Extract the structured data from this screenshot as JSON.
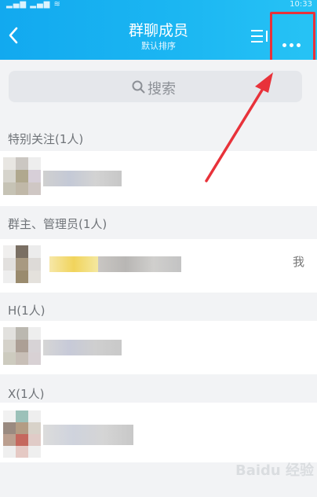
{
  "header": {
    "title": "群聊成员",
    "subtitle": "默认排序",
    "status_time": "10:33"
  },
  "search": {
    "placeholder": "搜索"
  },
  "sections": [
    {
      "label": "特别关注(1人)"
    },
    {
      "label": "群主、管理员(1人)"
    },
    {
      "label": "H(1人)"
    },
    {
      "label": "X(1人)"
    }
  ],
  "members": [
    {
      "role_tag": ""
    },
    {
      "role_tag": "我"
    },
    {
      "role_tag": ""
    },
    {
      "role_tag": ""
    }
  ],
  "watermark": "Baidu 经验",
  "colors": {
    "header": "#1bb6f2",
    "highlight": "#e8323a",
    "background": "#f2f3f5"
  }
}
